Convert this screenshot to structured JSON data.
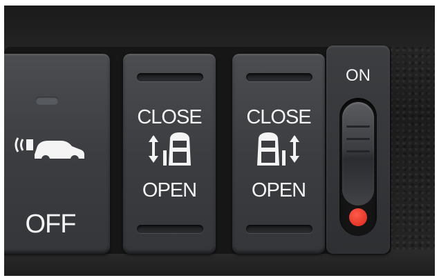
{
  "off_button": {
    "label": "OFF",
    "icon": "car-sensor-icon"
  },
  "door_left": {
    "top_label": "CLOSE",
    "bottom_label": "OPEN",
    "icon": "left-sliding-door-icon"
  },
  "door_right": {
    "top_label": "CLOSE",
    "bottom_label": "OPEN",
    "icon": "right-sliding-door-icon"
  },
  "main_switch": {
    "label": "ON",
    "indicator_color": "#e02a1c"
  }
}
